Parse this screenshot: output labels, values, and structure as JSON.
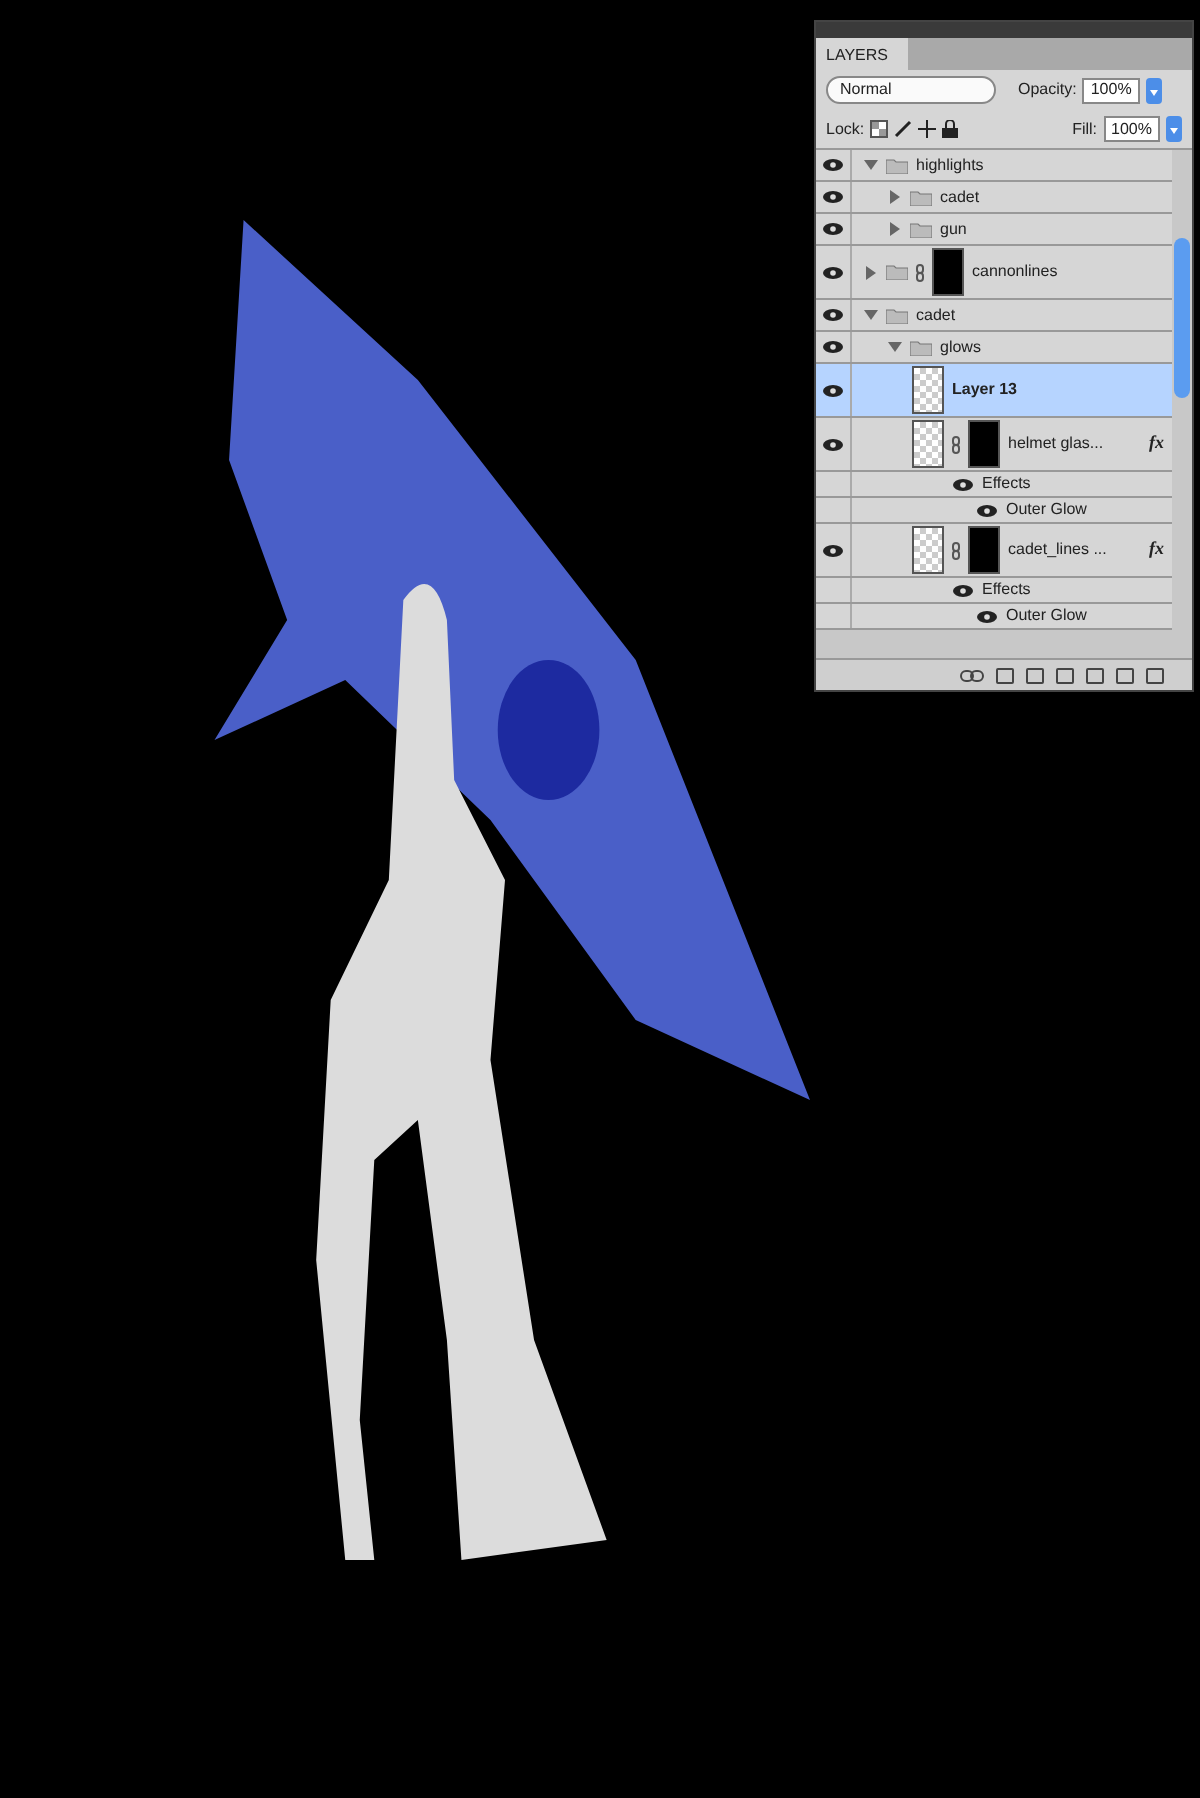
{
  "layers_panel": {
    "tab": "LAYERS",
    "blend_mode": "Normal",
    "opacity_label": "Opacity:",
    "opacity": "100%",
    "lock_label": "Lock:",
    "fill_label": "Fill:",
    "fill": "100%",
    "layers": [
      {
        "name": "highlights",
        "kind": "group",
        "visible": true,
        "expanded": true,
        "selected": false,
        "children": [
          {
            "name": "cadet",
            "kind": "group",
            "visible": true,
            "expanded": false,
            "selected": false
          },
          {
            "name": "gun",
            "kind": "group",
            "visible": true,
            "expanded": false,
            "selected": false
          }
        ]
      },
      {
        "name": "cannonlines",
        "kind": "group",
        "visible": true,
        "expanded": false,
        "selected": false,
        "mask": true
      },
      {
        "name": "cadet",
        "kind": "group",
        "visible": true,
        "expanded": true,
        "selected": false,
        "children": [
          {
            "name": "glows",
            "kind": "group",
            "visible": true,
            "expanded": true,
            "selected": false,
            "children": [
              {
                "name": "Layer 13",
                "kind": "layer",
                "visible": true,
                "selected": true
              },
              {
                "name": "helmet glas...",
                "kind": "layer",
                "visible": true,
                "selected": false,
                "mask": true,
                "fx": "fx",
                "effects_label": "Effects",
                "effects": [
                  "Outer Glow"
                ]
              },
              {
                "name": "cadet_lines ...",
                "kind": "layer",
                "visible": true,
                "selected": false,
                "mask": true,
                "fx": "fx",
                "effects_label": "Effects",
                "effects": [
                  "Outer Glow"
                ]
              }
            ]
          }
        ]
      }
    ]
  }
}
